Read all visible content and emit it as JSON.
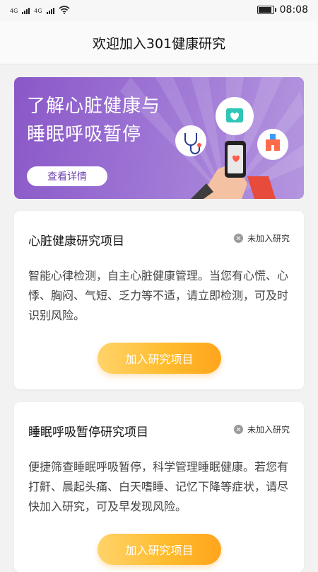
{
  "status_bar": {
    "network1": "4G",
    "network2": "4G",
    "time": "08:08"
  },
  "header": {
    "title": "欢迎加入301健康研究"
  },
  "banner": {
    "line1": "了解心脏健康与",
    "line2": "睡眠呼吸暂停",
    "button": "查看详情"
  },
  "cards": [
    {
      "title": "心脏健康研究项目",
      "status": "未加入研究",
      "description": "智能心律检测，自主心脏健康管理。当您有心慌、心悸、胸闷、气短、乏力等不适，请立即检测，可及时识别风险。",
      "button": "加入研究项目"
    },
    {
      "title": "睡眠呼吸暂停研究项目",
      "status": "未加入研究",
      "description": "便捷筛查睡眠呼吸暂停，科学管理睡眠健康。若您有打鼾、晨起头痛、白天嗜睡、记忆下降等症状，请尽快加入研究，可及早发现风险。",
      "button": "加入研究项目"
    }
  ],
  "colors": {
    "banner_purple": "#8a58c8",
    "button_orange": "#ffb02a"
  }
}
